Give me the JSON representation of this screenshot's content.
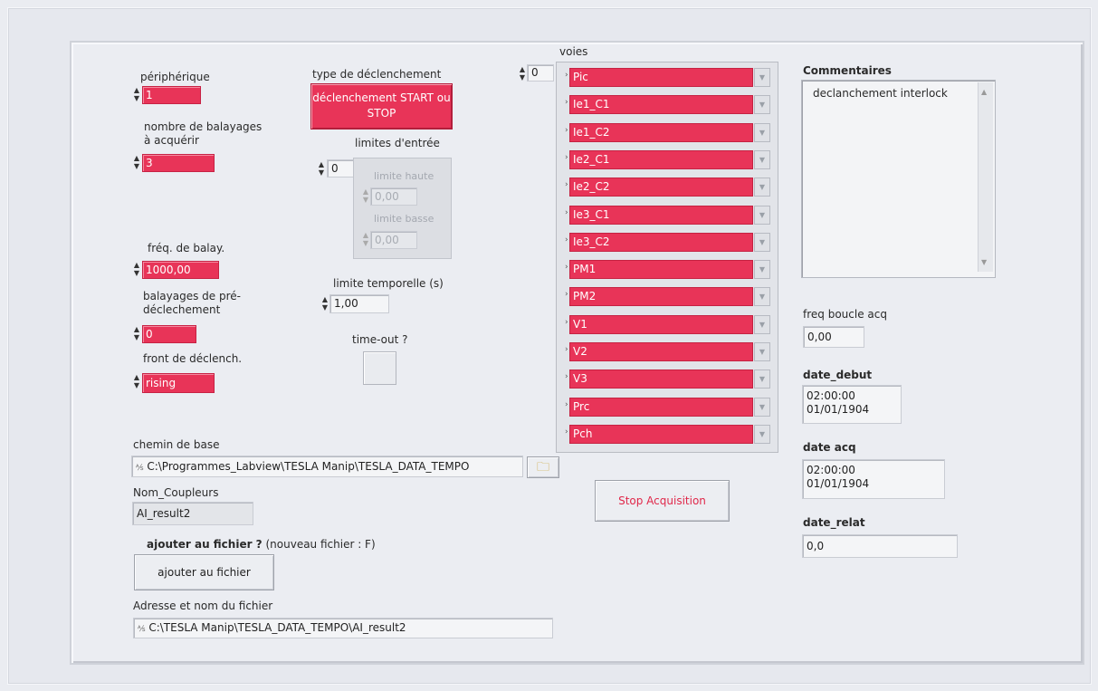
{
  "left": {
    "peripherique_label": "périphérique",
    "peripherique_value": "1",
    "nb_balayages_label": "nombre de balayages à acquérir",
    "nb_balayages_value": "3",
    "freq_label": "fréq. de balay.",
    "freq_value": "1000,00",
    "pre_decl_label": "balayages de pré-déclechement",
    "pre_decl_value": "0",
    "front_label": "front de déclench.",
    "front_value": "rising"
  },
  "middle": {
    "type_decl_label": "type de déclenchement",
    "type_decl_button": "déclenchement START ou STOP",
    "limites_label": "limites d'entrée",
    "limites_index": "0",
    "limite_haute_label": "limite haute",
    "limite_haute_value": "0,00",
    "limite_basse_label": "limite basse",
    "limite_basse_value": "0,00",
    "limite_temp_label": "limite temporelle (s)",
    "limite_temp_value": "1,00",
    "timeout_label": "time-out ?"
  },
  "voies": {
    "label": "voies",
    "index": "0",
    "channels": [
      "Pic",
      "Ie1_C1",
      "Ie1_C2",
      "Ie2_C1",
      "Ie2_C2",
      "Ie3_C1",
      "Ie3_C2",
      "PM1",
      "PM2",
      "V1",
      "V2",
      "V3",
      "Prc",
      "Pch"
    ]
  },
  "bottom": {
    "chemin_label": "chemin de base",
    "chemin_value": "C:\\Programmes_Labview\\TESLA Manip\\TESLA_DATA_TEMPO",
    "nom_coupleurs_label": "Nom_Coupleurs",
    "nom_coupleurs_value": "AI_result2",
    "ajouter_label_bold": "ajouter au fichier ?",
    "ajouter_label_rest": "(nouveau fichier : F)",
    "ajouter_button": "ajouter au fichier",
    "adresse_label": "Adresse et nom du fichier",
    "adresse_value": "C:\\TESLA Manip\\TESLA_DATA_TEMPO\\AI_result2",
    "stop_button": "Stop Acquisition"
  },
  "right": {
    "commentaires_label": "Commentaires",
    "commentaires_value": "declanchement interlock",
    "freq_boucle_label": "freq boucle acq",
    "freq_boucle_value": "0,00",
    "date_debut_label": "date_debut",
    "date_debut_time": "02:00:00",
    "date_debut_date": "01/01/1904",
    "date_acq_label": "date acq",
    "date_acq_time": "02:00:00",
    "date_acq_date": "01/01/1904",
    "date_relat_label": "date_relat",
    "date_relat_value": "0,0"
  },
  "colors": {
    "control_red": "#e83458",
    "stop_text": "#e0284a"
  }
}
